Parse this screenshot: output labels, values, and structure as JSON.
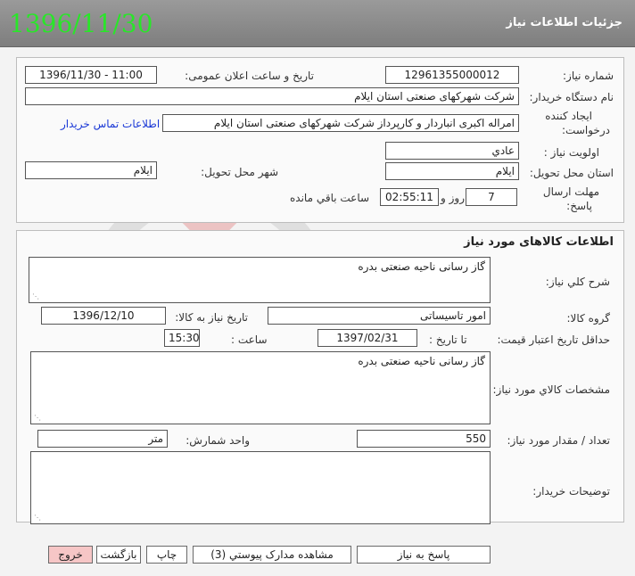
{
  "header": {
    "title": "جزئیات اطلاعات نیاز",
    "date": "1396/11/30"
  },
  "need_info": {
    "need_number_label": "شماره نیاز:",
    "need_number": "12961355000012",
    "announce_label": "تاریخ و ساعت اعلان عمومی:",
    "announce_value": "1396/11/30 - 11:00",
    "buyer_label": "نام دستگاه خریدار:",
    "buyer_value": "شرکت شهرکهای صنعتی استان ایلام",
    "creator_label_1": "ایجاد کننده",
    "creator_label_2": "درخواست:",
    "creator_value": "امراله اکبری انباردار و کارپرداز شرکت شهرکهای صنعتی استان ایلام",
    "contact_link": "اطلاعات تماس خریدار",
    "priority_label": "اولویت نیاز :",
    "priority_value": "عادي",
    "province_label": "استان محل تحویل:",
    "province_value": "ایلام",
    "city_label": "شهر محل تحویل:",
    "city_value": "ایلام",
    "deadline_label_1": "مهلت ارسال",
    "deadline_label_2": "پاسخ:",
    "days_value": "7",
    "days_suffix": "روز و",
    "time_value": "02:55:11",
    "remaining_label": "ساعت باقي مانده"
  },
  "goods": {
    "section_title": "اطلاعات کالاهای مورد نیاز",
    "desc_label": "شرح کلي نیاز:",
    "desc_value": "گاز رسانی ناحیه صنعتی بدره",
    "group_label": "گروه کالا:",
    "group_value": "امور تاسیساتی",
    "need_date_label": "تاریخ نیاز به کالا:",
    "need_date_value": "1396/12/10",
    "price_validity_label": "حداقل تاریخ اعتبار قیمت:",
    "to_date_label": "تا تاریخ :",
    "to_date_value": "1397/02/31",
    "hour_label": "ساعت :",
    "hour_value": "15:30",
    "spec_label": "مشخصات کالاي مورد نیاز:",
    "spec_value": "گاز رسانی ناحیه صنعتی بدره",
    "qty_label": "تعداد / مقدار مورد نیاز:",
    "qty_value": "550",
    "unit_label": "واحد شمارش:",
    "unit_value": "متر",
    "buyer_notes_label": "توضیحات خریدار:",
    "buyer_notes_value": ""
  },
  "buttons": {
    "reply": "پاسخ به نیاز",
    "attachments": "مشاهده مدارک پیوستي (3)",
    "print": "چاپ",
    "back": "بازگشت",
    "exit": "خروج"
  },
  "colors": {
    "accent_green": "#29e629",
    "link_blue": "#1a38d6",
    "exit_red": "#f6c6c6"
  }
}
